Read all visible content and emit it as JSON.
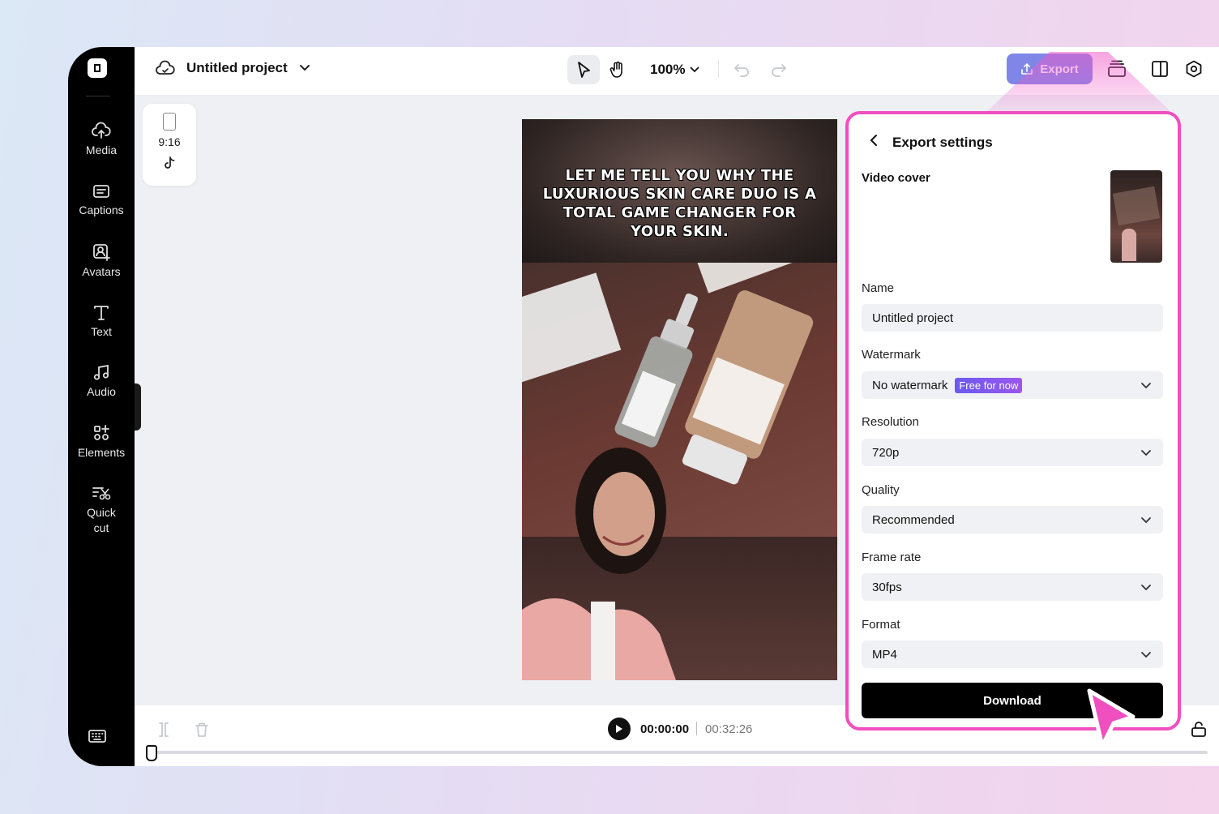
{
  "project": {
    "title": "Untitled project"
  },
  "toolbar": {
    "zoom": "100%",
    "export_label": "Export"
  },
  "sidebar": {
    "items": [
      {
        "label": "Media",
        "icon": "cloud-upload-icon"
      },
      {
        "label": "Captions",
        "icon": "captions-icon"
      },
      {
        "label": "Avatars",
        "icon": "avatar-icon"
      },
      {
        "label": "Text",
        "icon": "text-icon"
      },
      {
        "label": "Audio",
        "icon": "music-note-icon"
      },
      {
        "label": "Elements",
        "icon": "elements-icon"
      },
      {
        "label": "Quick\ncut",
        "icon": "quick-cut-icon"
      }
    ]
  },
  "canvas": {
    "ratio_label": "9:16",
    "caption": "LET ME TELL YOU WHY THE LUXURIOUS SKIN CARE DUO IS A TOTAL GAME CHANGER FOR YOUR SKIN."
  },
  "playback": {
    "current_time": "00:00:00",
    "total_time": "00:32:26"
  },
  "export_panel": {
    "title": "Export settings",
    "video_cover_label": "Video cover",
    "name_label": "Name",
    "name_value": "Untitled project",
    "watermark_label": "Watermark",
    "watermark_value": "No watermark",
    "watermark_badge": "Free for now",
    "resolution_label": "Resolution",
    "resolution_value": "720p",
    "quality_label": "Quality",
    "quality_value": "Recommended",
    "frame_rate_label": "Frame rate",
    "frame_rate_value": "30fps",
    "format_label": "Format",
    "format_value": "MP4",
    "download_label": "Download"
  },
  "colors": {
    "accent_export": "#7f86e8",
    "highlight_border": "#f04fbf",
    "badge_purple": "#7b4ef0"
  }
}
